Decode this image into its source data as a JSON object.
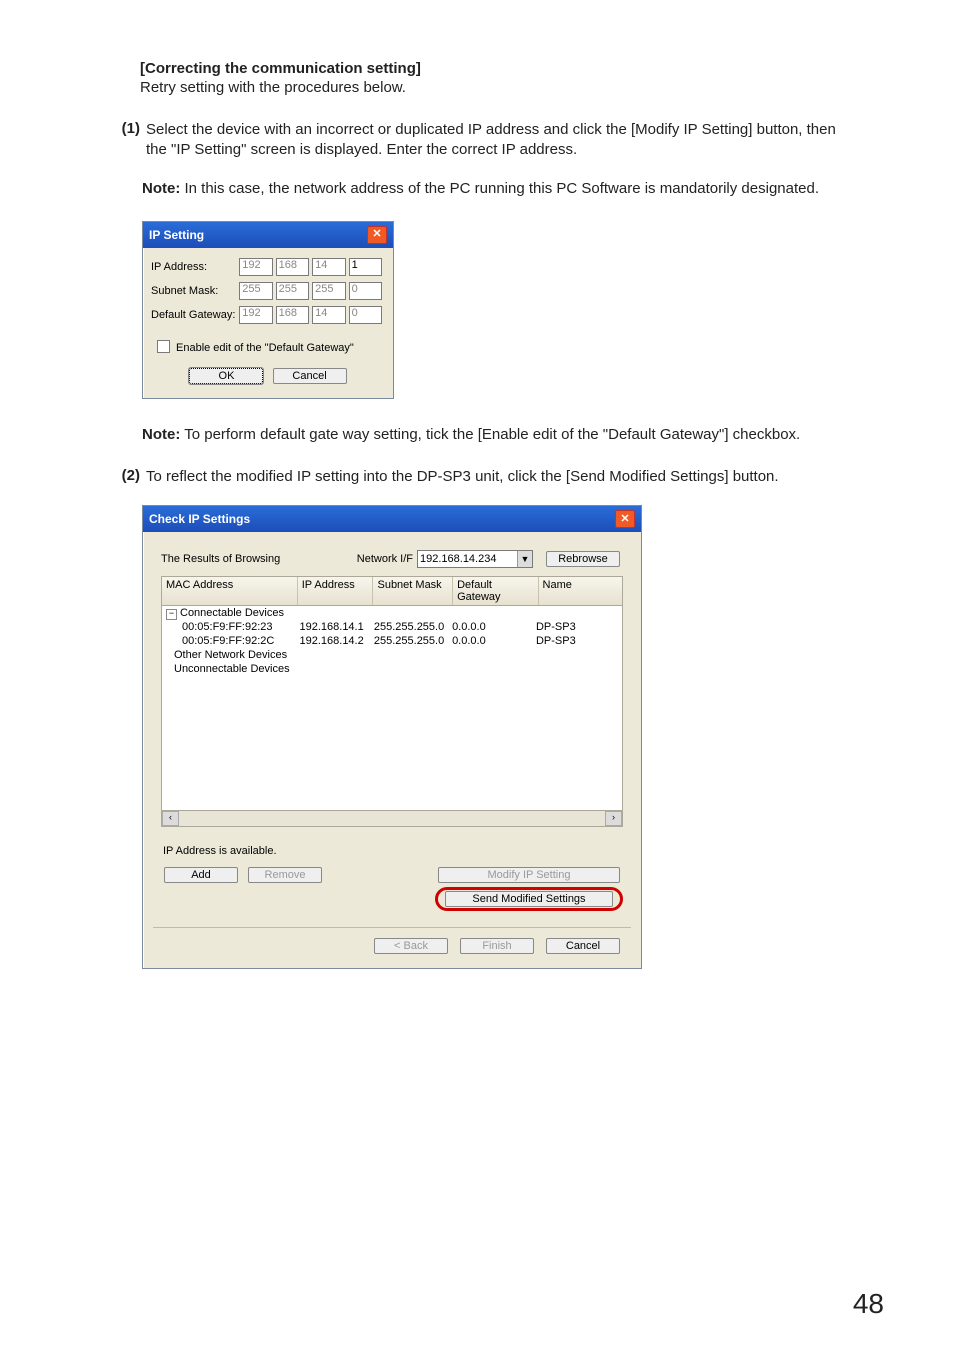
{
  "text": {
    "title": "[Correcting the communication setting]",
    "subtitle": "Retry setting with the procedures below.",
    "item1_num": "(1)",
    "item1_body": "Select the device with an incorrect or duplicated IP address and click the [Modify IP Setting] button, then the \"IP Setting\" screen is displayed. Enter the correct IP address.",
    "note1_strong": "Note:",
    "note1_body": " In this case, the network address of the PC running this PC Software is mandatorily designated.",
    "note2_strong": "Note:",
    "note2_body": " To perform default gate way setting, tick the [Enable edit of the \"Default Gateway\"] checkbox.",
    "item2_num": "(2)",
    "item2_body": "To reflect the modified IP setting into the DP-SP3 unit, click the [Send Modified Settings] button.",
    "page": "48"
  },
  "ip_dialog": {
    "title": "IP Setting",
    "labels": {
      "ip": "IP Address:",
      "subnet": "Subnet Mask:",
      "gateway": "Default Gateway:"
    },
    "ip": {
      "a": "192",
      "b": "168",
      "c": "14",
      "d": "1"
    },
    "subnet": {
      "a": "255",
      "b": "255",
      "c": "255",
      "d": "0"
    },
    "gateway": {
      "a": "192",
      "b": "168",
      "c": "14",
      "d": "0"
    },
    "checkbox": "Enable edit of the \"Default Gateway\"",
    "ok": "OK",
    "cancel": "Cancel"
  },
  "check_dialog": {
    "title": "Check IP Settings",
    "browse_label": "The Results of Browsing",
    "nif_label": "Network I/F",
    "nif_value": "192.168.14.234",
    "rebrowse": "Rebrowse",
    "headers": {
      "mac": "MAC Address",
      "ip": "IP Address",
      "subnet": "Subnet Mask",
      "gw": "Default Gateway",
      "name": "Name"
    },
    "tree": {
      "root": "Connectable Devices",
      "rows": [
        {
          "mac": "00:05:F9:FF:92:23",
          "ip": "192.168.14.1",
          "subnet": "255.255.255.0",
          "gw": "0.0.0.0",
          "name": "DP-SP3"
        },
        {
          "mac": "00:05:F9:FF:92:2C",
          "ip": "192.168.14.2",
          "subnet": "255.255.255.0",
          "gw": "0.0.0.0",
          "name": "DP-SP3"
        }
      ],
      "other": "Other Network Devices",
      "unconn": "Unconnectable Devices"
    },
    "status": "IP Address is available.",
    "add": "Add",
    "remove": "Remove",
    "modify": "Modify IP Setting",
    "send": "Send Modified Settings",
    "back": "< Back",
    "finish": "Finish",
    "cancel": "Cancel"
  }
}
